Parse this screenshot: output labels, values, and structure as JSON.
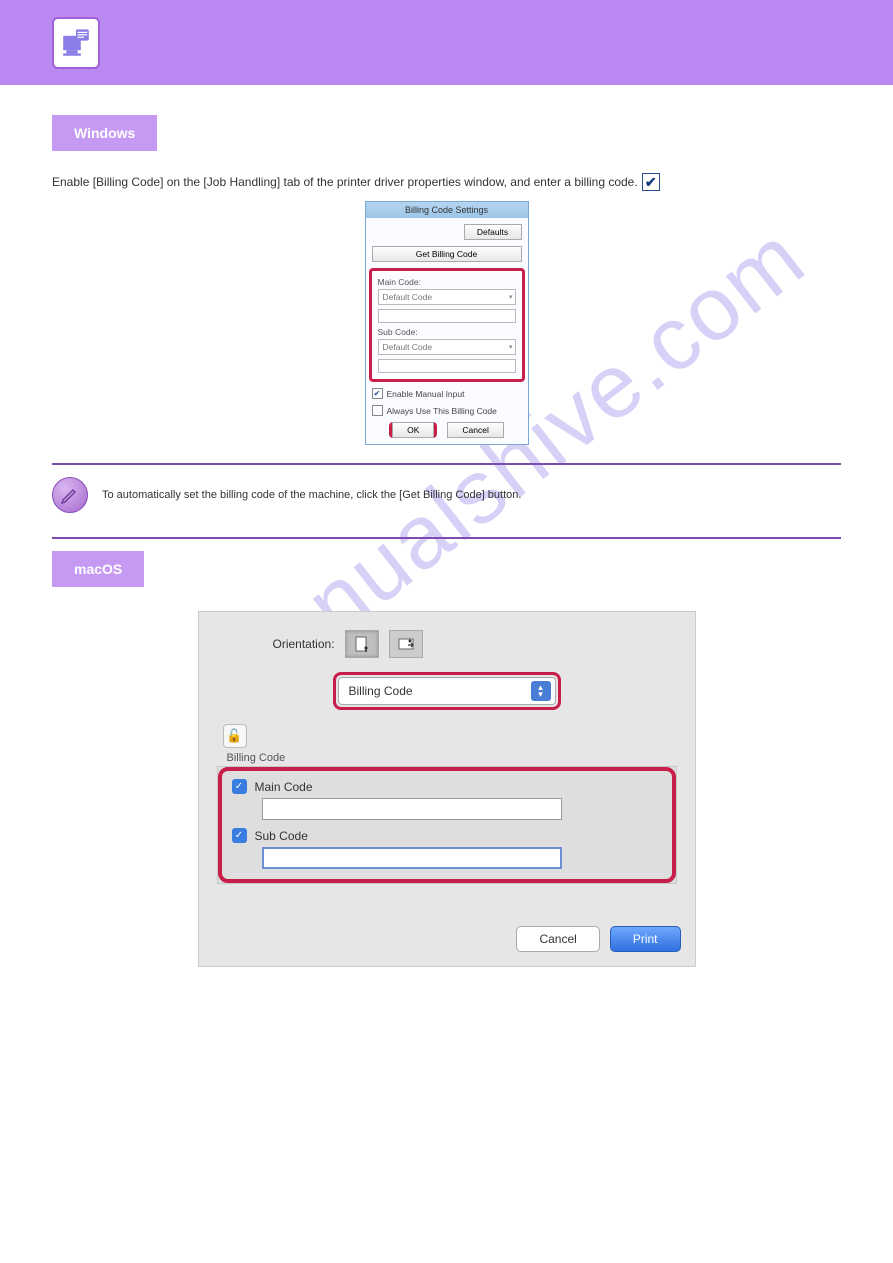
{
  "watermark": "manualshive.com",
  "sections": {
    "windows": "Windows",
    "macos": "macOS"
  },
  "instruction_windows": "Enable [Billing Code] on the [Job Handling] tab of the printer driver properties window, and enter a billing code.",
  "win_dialog": {
    "title": "Billing Code Settings",
    "defaults": "Defaults",
    "get_billing": "Get Billing Code",
    "main_code_label": "Main Code:",
    "default_code": "Default Code",
    "sub_code_label": "Sub Code:",
    "enable_manual": "Enable Manual Input",
    "always_use": "Always Use This Billing Code",
    "ok": "OK",
    "cancel": "Cancel"
  },
  "note": "To automatically set the billing code of the machine, click the [Get Billing Code] button.",
  "mac_dialog": {
    "orientation_label": "Orientation:",
    "combo_value": "Billing Code",
    "billing_label": "Billing Code",
    "main_code": "Main Code",
    "sub_code": "Sub Code",
    "cancel": "Cancel",
    "print": "Print"
  }
}
